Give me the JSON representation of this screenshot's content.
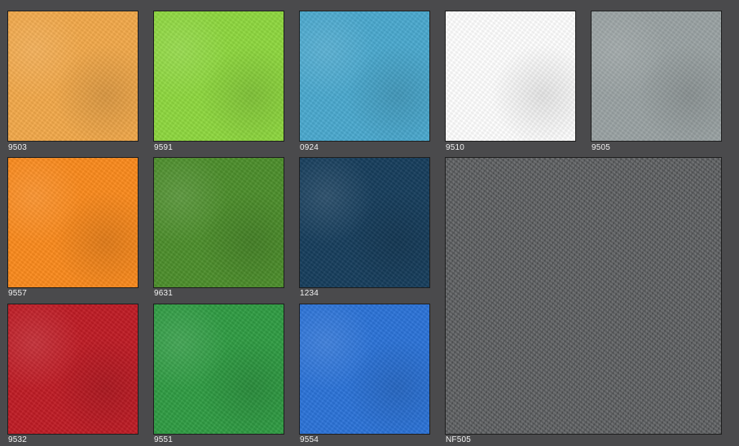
{
  "swatches": [
    {
      "code": "9503",
      "color": "#f3a94a"
    },
    {
      "code": "9591",
      "color": "#8ed83e"
    },
    {
      "code": "0924",
      "color": "#4aa9cf"
    },
    {
      "code": "9510",
      "color": "#ffffff"
    },
    {
      "code": "9505",
      "color": "#9aa2a3"
    },
    {
      "code": "9557",
      "color": "#fb8a1c"
    },
    {
      "code": "9631",
      "color": "#4c8e2b"
    },
    {
      "code": "1234",
      "color": "#163d5c"
    },
    {
      "code": "NF505",
      "color": "#5b5d5f"
    },
    {
      "code": "9532",
      "color": "#bf1b24"
    },
    {
      "code": "9551",
      "color": "#2f9c43"
    },
    {
      "code": "9554",
      "color": "#2b73d8"
    }
  ]
}
